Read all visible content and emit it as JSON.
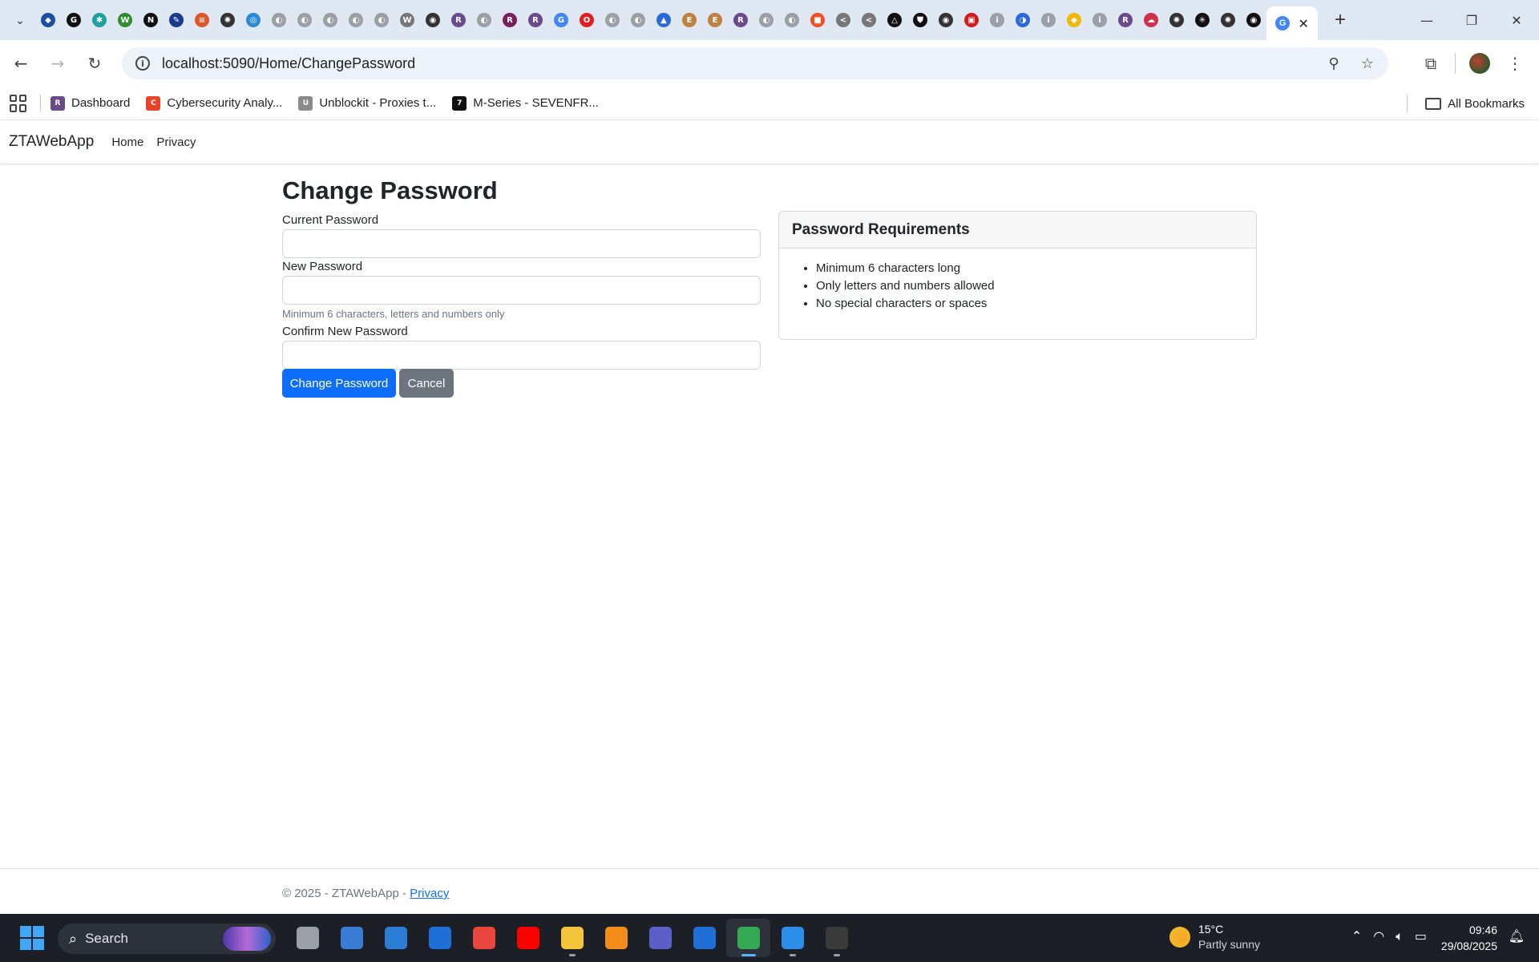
{
  "browser": {
    "pinned_tabs": [
      {
        "icon": "shield-bird-icon",
        "color": "#1a4fa3",
        "glyph": "◆"
      },
      {
        "icon": "grammarly-icon",
        "color": "#111111",
        "glyph": "G"
      },
      {
        "icon": "lattice-icon",
        "color": "#20a0a0",
        "glyph": "✱"
      },
      {
        "icon": "wordwall-icon",
        "color": "#2f8f2f",
        "glyph": "W"
      },
      {
        "icon": "notion-icon",
        "color": "#111111",
        "glyph": "N"
      },
      {
        "icon": "quill-icon",
        "color": "#1a3a8a",
        "glyph": "✎"
      },
      {
        "icon": "stripes-icon",
        "color": "#e0562a",
        "glyph": "≡"
      },
      {
        "icon": "openai-icon",
        "color": "#333333",
        "glyph": "✺"
      },
      {
        "icon": "target-icon",
        "color": "#2a8ad8",
        "glyph": "◎"
      },
      {
        "icon": "globe-icon",
        "color": "#9aa0a6",
        "glyph": "◐"
      },
      {
        "icon": "globe-icon",
        "color": "#9aa0a6",
        "glyph": "◐"
      },
      {
        "icon": "globe-icon",
        "color": "#9aa0a6",
        "glyph": "◐"
      },
      {
        "icon": "globe-icon",
        "color": "#9aa0a6",
        "glyph": "◐"
      },
      {
        "icon": "globe-icon",
        "color": "#9aa0a6",
        "glyph": "◐"
      },
      {
        "icon": "wikipedia-icon",
        "color": "#777777",
        "glyph": "W"
      },
      {
        "icon": "github-icon",
        "color": "#333333",
        "glyph": "◉"
      },
      {
        "icon": "rgu-icon",
        "color": "#6b4a8a",
        "glyph": "R"
      },
      {
        "icon": "globe-icon",
        "color": "#9aa0a6",
        "glyph": "◐"
      },
      {
        "icon": "rgu-icon",
        "color": "#7a1f5a",
        "glyph": "R"
      },
      {
        "icon": "rgu-icon",
        "color": "#6b4a8a",
        "glyph": "R"
      },
      {
        "icon": "google-icon",
        "color": "#4285f4",
        "glyph": "G"
      },
      {
        "icon": "opera-icon",
        "color": "#e02020",
        "glyph": "O"
      },
      {
        "icon": "globe-icon",
        "color": "#9aa0a6",
        "glyph": "◐"
      },
      {
        "icon": "globe-icon",
        "color": "#9aa0a6",
        "glyph": "◐"
      },
      {
        "icon": "graduation-cap-icon",
        "color": "#2a6ad8",
        "glyph": "▲"
      },
      {
        "icon": "e-icon",
        "color": "#c08040",
        "glyph": "E"
      },
      {
        "icon": "e-icon",
        "color": "#c08040",
        "glyph": "E"
      },
      {
        "icon": "rgu-icon",
        "color": "#6b4a8a",
        "glyph": "R"
      },
      {
        "icon": "globe-icon",
        "color": "#9aa0a6",
        "glyph": "◐"
      },
      {
        "icon": "globe-icon",
        "color": "#9aa0a6",
        "glyph": "◐"
      },
      {
        "icon": "microsoft-icon",
        "color": "#f25022",
        "glyph": "■"
      },
      {
        "icon": "share-icon",
        "color": "#777777",
        "glyph": "<"
      },
      {
        "icon": "share-icon",
        "color": "#777777",
        "glyph": "<"
      },
      {
        "icon": "triangle-icon",
        "color": "#111111",
        "glyph": "△"
      },
      {
        "icon": "shield-icon",
        "color": "#111111",
        "glyph": "⛊"
      },
      {
        "icon": "github-icon",
        "color": "#333333",
        "glyph": "◉"
      },
      {
        "icon": "cart-icon",
        "color": "#d01c1c",
        "glyph": "▣"
      },
      {
        "icon": "info-icon",
        "color": "#9aa0a6",
        "glyph": "i"
      },
      {
        "icon": "brain-icon",
        "color": "#2a6ad8",
        "glyph": "◑"
      },
      {
        "icon": "info-icon",
        "color": "#9aa0a6",
        "glyph": "i"
      },
      {
        "icon": "binance-icon",
        "color": "#f0b90b",
        "glyph": "◆"
      },
      {
        "icon": "info-icon",
        "color": "#9aa0a6",
        "glyph": "i"
      },
      {
        "icon": "rgu-icon",
        "color": "#6b4a8a",
        "glyph": "R"
      },
      {
        "icon": "cloud-icon",
        "color": "#d03050",
        "glyph": "☁"
      },
      {
        "icon": "openai-icon",
        "color": "#333333",
        "glyph": "✺"
      },
      {
        "icon": "perplexity-icon",
        "color": "#111111",
        "glyph": "✳"
      },
      {
        "icon": "openai-icon",
        "color": "#333333",
        "glyph": "✺"
      },
      {
        "icon": "github-icon",
        "color": "#111111",
        "glyph": "◉"
      }
    ],
    "active_tab_icon": "google-icon",
    "url": "localhost:5090/Home/ChangePassword",
    "bookmarks": [
      {
        "label": "Dashboard",
        "icon": "rgu-icon",
        "color": "#6b4a8a",
        "glyph": "R"
      },
      {
        "label": "Cybersecurity Analy...",
        "icon": "coursera-icon",
        "color": "#e8442a",
        "glyph": "C"
      },
      {
        "label": "Unblockit - Proxies t...",
        "icon": "unblockit-icon",
        "color": "#8a8a8a",
        "glyph": "U"
      },
      {
        "label": "M-Series - SEVENFR...",
        "icon": "sevenfriday-icon",
        "color": "#111111",
        "glyph": "7"
      }
    ],
    "all_bookmarks_label": "All Bookmarks"
  },
  "app": {
    "brand": "ZTAWebApp",
    "nav": [
      "Home",
      "Privacy"
    ],
    "page_title": "Change Password",
    "form": {
      "current_label": "Current Password",
      "current_value": "",
      "new_label": "New Password",
      "new_value": "",
      "new_help": "Minimum 6 characters, letters and numbers only",
      "confirm_label": "Confirm New Password",
      "confirm_value": "",
      "submit_label": "Change Password",
      "cancel_label": "Cancel"
    },
    "requirements": {
      "title": "Password Requirements",
      "items": [
        "Minimum 6 characters long",
        "Only letters and numbers allowed",
        "No special characters or spaces"
      ]
    },
    "footer": {
      "text": "© 2025 - ZTAWebApp - ",
      "link": "Privacy"
    },
    "colors": {
      "primary": "#0d6efd",
      "secondary": "#6c757d"
    }
  },
  "taskbar": {
    "search_label": "Search",
    "apps": [
      {
        "icon": "task-view-icon",
        "color": "#9aa0a6"
      },
      {
        "icon": "copilot-icon",
        "color": "#3a7bd5"
      },
      {
        "icon": "microsoft-store-icon",
        "color": "#2b7cd3"
      },
      {
        "icon": "azure-icon",
        "color": "#1f6fd6"
      },
      {
        "icon": "chrome-icon",
        "color": "#e8453c"
      },
      {
        "icon": "youtube-icon",
        "color": "#ff0000"
      },
      {
        "icon": "file-explorer-icon",
        "color": "#f3c33b"
      },
      {
        "icon": "vlc-icon",
        "color": "#f28c1b"
      },
      {
        "icon": "teams-icon",
        "color": "#5b5fc7"
      },
      {
        "icon": "prime-video-icon",
        "color": "#1f6fd6"
      },
      {
        "icon": "chrome-icon",
        "color": "#34a853",
        "active": true
      },
      {
        "icon": "vscode-icon",
        "color": "#2b8ee8"
      },
      {
        "icon": "terminal-icon",
        "color": "#3a3a3a"
      }
    ],
    "weather": {
      "temp": "15°C",
      "condition": "Partly sunny"
    },
    "time": "09:46",
    "date": "29/08/2025"
  }
}
